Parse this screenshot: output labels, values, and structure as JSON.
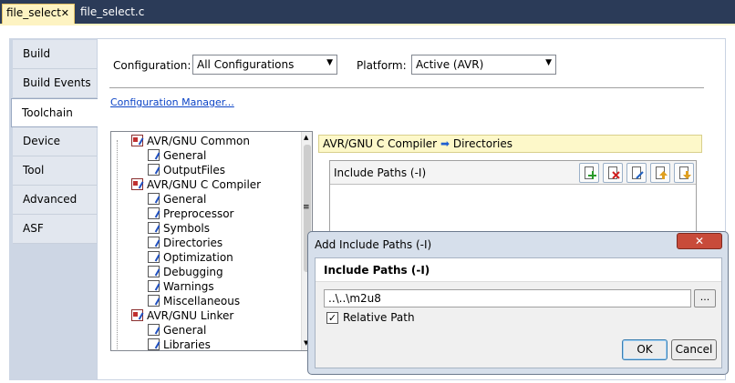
{
  "tabs": [
    {
      "label": "file_select",
      "active": true,
      "close_glyph": "✕"
    },
    {
      "label": "file_select.c",
      "active": false
    }
  ],
  "nav": {
    "items": [
      "Build",
      "Build Events",
      "Toolchain",
      "Device",
      "Tool",
      "Advanced",
      "ASF"
    ],
    "active": "Toolchain"
  },
  "config": {
    "configuration_label": "Configuration:",
    "configuration_value": "All Configurations",
    "platform_label": "Platform:",
    "platform_value": "Active (AVR)",
    "manager_link": "Configuration Manager..."
  },
  "tree": {
    "items": [
      {
        "label": "AVR/GNU Common",
        "level": 0
      },
      {
        "label": "General",
        "level": 1
      },
      {
        "label": "OutputFiles",
        "level": 1
      },
      {
        "label": "AVR/GNU C Compiler",
        "level": 0
      },
      {
        "label": "General",
        "level": 1
      },
      {
        "label": "Preprocessor",
        "level": 1
      },
      {
        "label": "Symbols",
        "level": 1
      },
      {
        "label": "Directories",
        "level": 1
      },
      {
        "label": "Optimization",
        "level": 1
      },
      {
        "label": "Debugging",
        "level": 1
      },
      {
        "label": "Warnings",
        "level": 1
      },
      {
        "label": "Miscellaneous",
        "level": 1
      },
      {
        "label": "AVR/GNU Linker",
        "level": 0
      },
      {
        "label": "General",
        "level": 1
      },
      {
        "label": "Libraries",
        "level": 1
      }
    ]
  },
  "breadcrumb": {
    "part1": "AVR/GNU C Compiler",
    "arrow": "➡",
    "part2": "Directories"
  },
  "include_paths": {
    "title": "Include Paths (-I)",
    "toolbar": [
      "add-item-icon",
      "delete-item-icon",
      "edit-item-icon",
      "move-up-icon",
      "move-down-icon"
    ]
  },
  "dialog": {
    "title": "Add Include Paths (-I)",
    "close_glyph": "✕",
    "header": "Include Paths (-I)",
    "path_value": "..\\..\\m2u8",
    "browse_label": "...",
    "relative_checked": true,
    "check_glyph": "✓",
    "relative_label": "Relative Path",
    "ok_label": "OK",
    "cancel_label": "Cancel"
  },
  "colors": {
    "tab_active": "#fdf3c2",
    "breadcrumb_bg": "#fdf8c9",
    "dialog_close": "#c84b3a",
    "link": "#0b43c6"
  }
}
